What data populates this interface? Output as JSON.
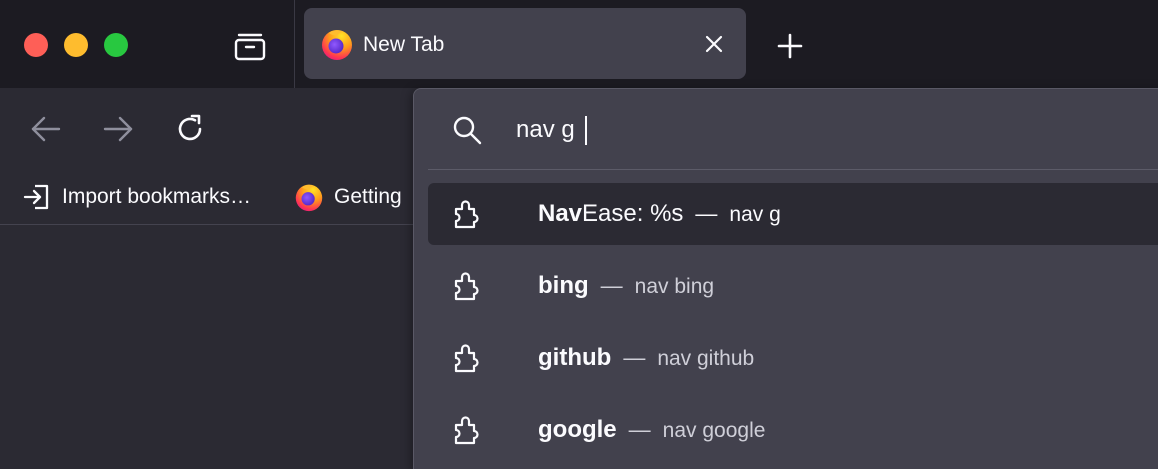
{
  "window": {
    "tab": {
      "title": "New Tab"
    },
    "colors": {
      "close": "#fe5f57",
      "minimize": "#febc2e",
      "zoom": "#28c840"
    }
  },
  "bookmarks": {
    "items": [
      {
        "label": "Import bookmarks…",
        "icon": "import-icon"
      },
      {
        "label": "Getting",
        "icon": "firefox-icon"
      }
    ]
  },
  "urlbar": {
    "value": "nav g",
    "results": [
      {
        "strong": "Nav",
        "rest": "Ease: %s",
        "dash": "—",
        "action": "nav g",
        "icon": "puzzle-icon",
        "selected": true
      },
      {
        "strong": "bing",
        "rest": "",
        "dash": "—",
        "action": "nav bing",
        "icon": "puzzle-icon"
      },
      {
        "strong": "g",
        "rest": "ithub",
        "dash": "—",
        "action": "nav github",
        "icon": "puzzle-icon"
      },
      {
        "strong": "google",
        "rest": "",
        "dash": "—",
        "action": "nav google",
        "icon": "puzzle-icon"
      }
    ]
  }
}
